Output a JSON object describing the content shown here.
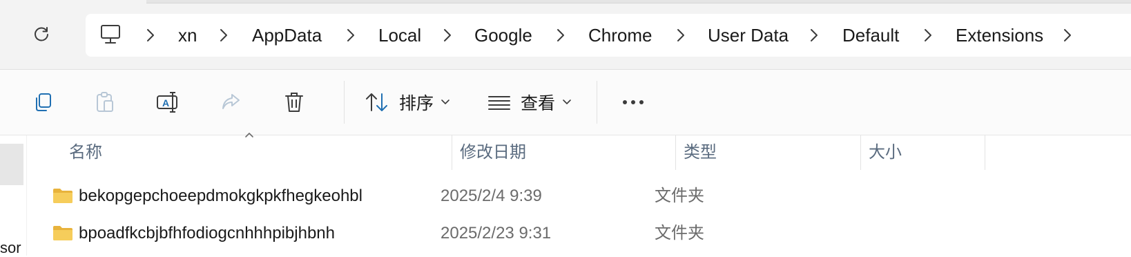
{
  "breadcrumbs": [
    "xn",
    "AppData",
    "Local",
    "Google",
    "Chrome",
    "User Data",
    "Default",
    "Extensions"
  ],
  "toolbar": {
    "sort_label": "排序",
    "view_label": "查看"
  },
  "columns": {
    "name": "名称",
    "modified": "修改日期",
    "type": "类型",
    "size": "大小"
  },
  "files": [
    {
      "name": "bekopgepchoeepdmokgkpkfhegkeohbl",
      "modified": "2025/2/4 9:39",
      "type": "文件夹",
      "size": ""
    },
    {
      "name": "bpoadfkcbjbfhfodiogcnhhhpibjhbnh",
      "modified": "2025/2/23 9:31",
      "type": "文件夹",
      "size": ""
    }
  ],
  "leftnav": {
    "cut_text": "sor"
  },
  "colors": {
    "header_text": "#5a6b7f",
    "folder": "#f4c64f",
    "accent": "#1f6fb2"
  },
  "icons": [
    "refresh-icon",
    "computer-icon",
    "copy-icon",
    "paste-icon",
    "rename-icon",
    "share-icon",
    "delete-icon",
    "sort-icon",
    "view-icon",
    "more-icon",
    "folder-icon"
  ]
}
